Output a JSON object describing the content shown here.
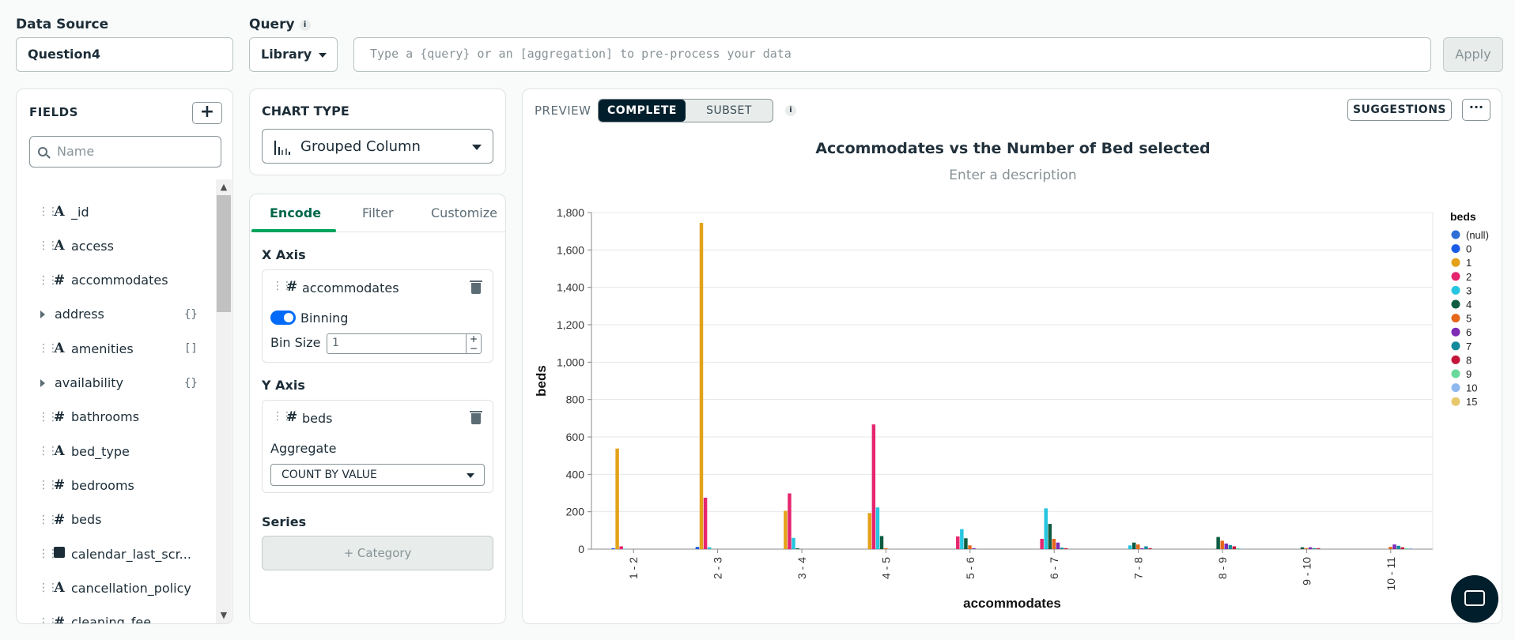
{
  "header": {
    "data_source_label": "Data Source",
    "data_source_value": "Question4",
    "query_label": "Query",
    "query_info": "i",
    "library_label": "Library",
    "query_placeholder": "Type a {query} or an [aggregation] to pre-process your data",
    "apply_label": "Apply"
  },
  "fields": {
    "title": "FIELDS",
    "add_label": "+",
    "search_placeholder": "Name",
    "items": [
      {
        "type": "A",
        "name": "_id",
        "kind": "string"
      },
      {
        "type": "A",
        "name": "access",
        "kind": "string"
      },
      {
        "type": "#",
        "name": "accommodates",
        "kind": "number"
      },
      {
        "type": "",
        "name": "address",
        "kind": "object",
        "badge": "{}"
      },
      {
        "type": "A",
        "name": "amenities",
        "kind": "array",
        "badge": "[]"
      },
      {
        "type": "",
        "name": "availability",
        "kind": "object",
        "badge": "{}"
      },
      {
        "type": "#",
        "name": "bathrooms",
        "kind": "number"
      },
      {
        "type": "A",
        "name": "bed_type",
        "kind": "string"
      },
      {
        "type": "#",
        "name": "bedrooms",
        "kind": "number"
      },
      {
        "type": "#",
        "name": "beds",
        "kind": "number"
      },
      {
        "type": "cal",
        "name": "calendar_last_scr...",
        "kind": "date"
      },
      {
        "type": "A",
        "name": "cancellation_policy",
        "kind": "string"
      },
      {
        "type": "#",
        "name": "cleaning_fee",
        "kind": "number"
      }
    ]
  },
  "chart_type": {
    "title": "CHART TYPE",
    "selected": "Grouped Column"
  },
  "encode": {
    "tabs": [
      "Encode",
      "Filter",
      "Customize"
    ],
    "x_axis_title": "X Axis",
    "x_field": "accommodates",
    "binning_label": "Binning",
    "bin_size_label": "Bin Size",
    "bin_size_value": "1",
    "y_axis_title": "Y Axis",
    "y_field": "beds",
    "aggregate_label": "Aggregate",
    "aggregate_value": "COUNT BY VALUE",
    "series_title": "Series",
    "category_button": "+ Category"
  },
  "preview": {
    "label": "PREVIEW",
    "complete_label": "COMPLETE",
    "subset_label": "SUBSET",
    "info": "i",
    "suggestions_label": "SUGGESTIONS",
    "more_label": "···",
    "title": "Accommodates vs  the Number of Bed selected",
    "description_placeholder": "Enter a description"
  },
  "chart_data": {
    "type": "bar",
    "title": "Accommodates vs  the Number of Bed selected",
    "xlabel": "accommodates",
    "ylabel": "beds",
    "ylim": [
      0,
      1800
    ],
    "yticks": [
      0,
      200,
      400,
      600,
      800,
      1000,
      1200,
      1400,
      1600,
      1800
    ],
    "ytick_labels": [
      "0",
      "200",
      "400",
      "600",
      "800",
      "1,000",
      "1,200",
      "1,400",
      "1,600",
      "1,800"
    ],
    "categories": [
      "1 - 2",
      "2 - 3",
      "3 - 4",
      "4 - 5",
      "5 - 6",
      "6 - 7",
      "7 - 8",
      "8 - 9",
      "9 - 10",
      "10 - 11"
    ],
    "legend_title": "beds",
    "legend_position": "right",
    "series": [
      {
        "name": "(null)",
        "color": "#2e6fd6",
        "values": [
          0,
          0,
          0,
          0,
          0,
          0,
          0,
          0,
          0,
          0
        ]
      },
      {
        "name": "0",
        "color": "#1a5ce6",
        "values": [
          5,
          12,
          0,
          0,
          0,
          0,
          0,
          0,
          0,
          0
        ]
      },
      {
        "name": "1",
        "color": "#e3a21a",
        "values": [
          538,
          1745,
          205,
          193,
          0,
          0,
          0,
          0,
          0,
          0
        ]
      },
      {
        "name": "2",
        "color": "#e5266f",
        "values": [
          15,
          275,
          298,
          667,
          68,
          55,
          0,
          0,
          0,
          0
        ]
      },
      {
        "name": "3",
        "color": "#26c6e0",
        "values": [
          2,
          10,
          60,
          223,
          107,
          218,
          20,
          0,
          0,
          0
        ]
      },
      {
        "name": "4",
        "color": "#0e5c41",
        "values": [
          0,
          0,
          5,
          70,
          58,
          135,
          35,
          65,
          10,
          0
        ]
      },
      {
        "name": "5",
        "color": "#e5671b",
        "values": [
          0,
          0,
          0,
          5,
          20,
          55,
          25,
          45,
          5,
          12
        ]
      },
      {
        "name": "6",
        "color": "#7e2bb5",
        "values": [
          0,
          0,
          0,
          0,
          5,
          35,
          5,
          30,
          10,
          25
        ]
      },
      {
        "name": "7",
        "color": "#138a9c",
        "values": [
          0,
          0,
          0,
          0,
          0,
          8,
          15,
          22,
          5,
          18
        ]
      },
      {
        "name": "8",
        "color": "#c4163a",
        "values": [
          0,
          0,
          0,
          0,
          0,
          5,
          5,
          15,
          5,
          10
        ]
      },
      {
        "name": "9",
        "color": "#68d99a",
        "values": [
          0,
          0,
          0,
          0,
          0,
          0,
          0,
          5,
          0,
          5
        ]
      },
      {
        "name": "10",
        "color": "#8fb8f0",
        "values": [
          0,
          0,
          0,
          0,
          0,
          0,
          0,
          3,
          0,
          5
        ]
      },
      {
        "name": "15",
        "color": "#e8c86c",
        "values": [
          0,
          0,
          0,
          0,
          0,
          0,
          0,
          0,
          0,
          0
        ]
      }
    ]
  }
}
